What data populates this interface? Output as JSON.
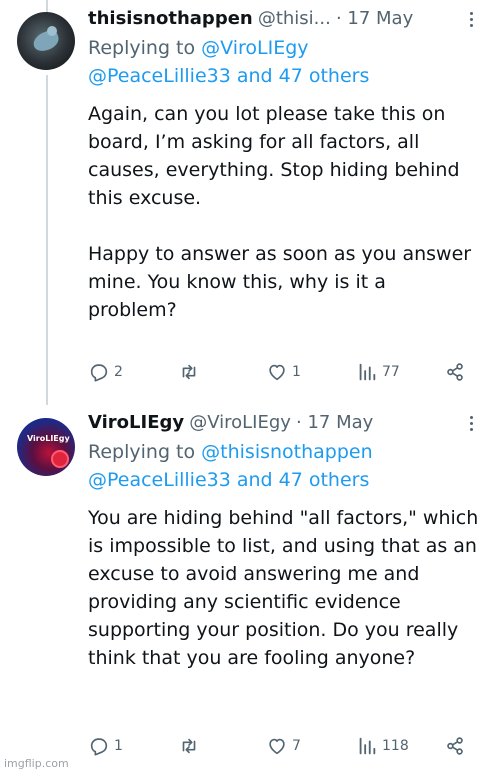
{
  "tweets": [
    {
      "name": "thisisnothappen",
      "handle": "@thisi...",
      "date": "· 17 May",
      "replying_prefix": "Replying to ",
      "replying_mention": "@ViroLIEgy",
      "mention_line": "@PeaceLillie33 and 47 others",
      "paragraphs": [
        "Again, can you lot please take this on board, I’m asking for all factors, all causes, everything. Stop hiding behind this excuse.",
        "Happy to answer as soon as you answer mine. You know this, why is it a problem?"
      ],
      "replies": "2",
      "retweets": "",
      "likes": "1",
      "views": "77"
    },
    {
      "name": "ViroLIEgy",
      "handle": "@ViroLIEgy",
      "date": "· 17 May",
      "replying_prefix": "Replying to ",
      "replying_mention": "@thisisnothappen",
      "mention_line": "@PeaceLillie33 and 47 others",
      "avatar_text": "ViroLIEgy",
      "paragraphs": [
        "You are hiding behind \"all factors,\" which is impossible to list, and using that as an excuse to avoid answering me and providing any scientific evidence supporting your position. Do you really think that you are fooling anyone?"
      ],
      "replies": "1",
      "retweets": "",
      "likes": "7",
      "views": "118"
    }
  ],
  "watermark": "imgflip.com",
  "icons": [
    "reply-icon",
    "retweet-icon",
    "like-icon",
    "views-icon",
    "share-icon",
    "more-icon"
  ],
  "colors": {
    "link": "#1d9bf0",
    "muted": "#536471",
    "text": "#0f1419",
    "thread": "#cfd9de"
  }
}
